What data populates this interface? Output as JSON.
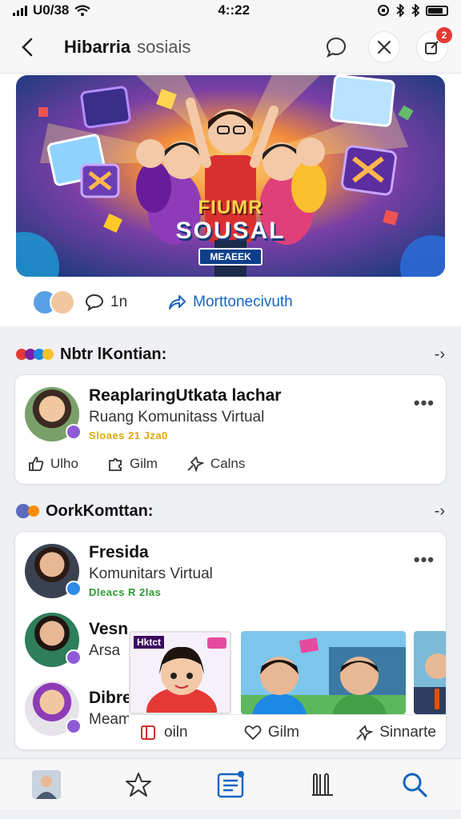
{
  "status_bar": {
    "carrier": "U0/38",
    "time": "4::22"
  },
  "header": {
    "title_bold": "Hibarria",
    "title_light": "sosiais",
    "notification_count": "2"
  },
  "feed": {
    "banner_title": "FIUMR",
    "banner_subtitle": "SOUSAL",
    "banner_tag": "MEAEEK",
    "comment_count": "1n",
    "share_label": "Morttonecivuth"
  },
  "section1": {
    "title": "Nbtr lKontian:",
    "card": {
      "name": "ReaplaringUtkata lachar",
      "subtitle": "Ruang Komunitass Virtual",
      "meta": "Sloaes 21 Jza0",
      "actions": [
        "Ulho",
        "Gilm",
        "Calns"
      ]
    }
  },
  "section2": {
    "title": "OorkKomttan:",
    "card": {
      "name": "Fresida",
      "subtitle": "Komunitars Virtual",
      "meta": "Dleacs R 2las",
      "rows": [
        {
          "name": "Vesn",
          "subtitle": "Arsa"
        },
        {
          "name": "Dibre",
          "subtitle": "Meam"
        }
      ],
      "overlay_tag": "Hktct",
      "actions": [
        "oiln",
        "Gilm",
        "Sinnarte"
      ]
    }
  },
  "colors": {
    "accent": "#1565c0",
    "badge": "#e53935",
    "meta_yellow": "#e0a800",
    "meta_green": "#2e9b2e"
  }
}
